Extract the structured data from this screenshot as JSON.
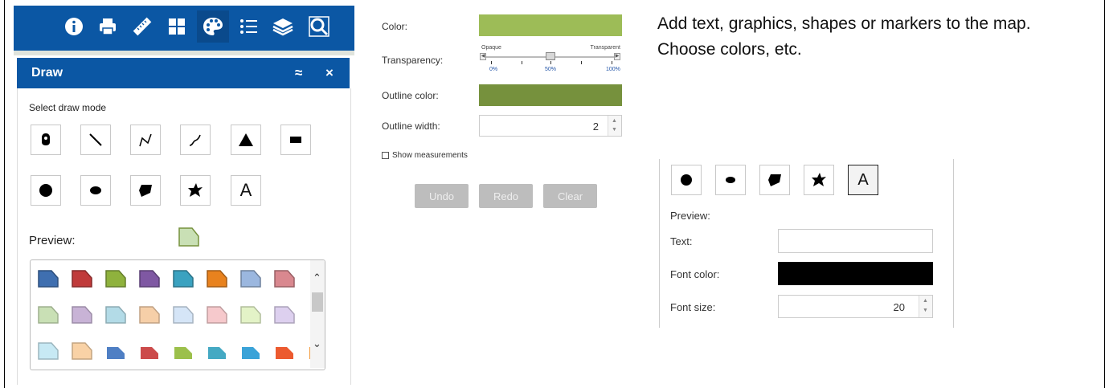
{
  "toolbar": {
    "icons": [
      "info-icon",
      "print-icon",
      "measure-icon",
      "basemap-gallery-icon",
      "draw-icon",
      "legend-icon",
      "layers-icon",
      "search-icon"
    ]
  },
  "draw_panel": {
    "title": "Draw",
    "collapse_glyph": "≈",
    "close_glyph": "×",
    "select_mode_label": "Select draw mode",
    "preview_label": "Preview:",
    "modes": [
      "point",
      "line",
      "polyline",
      "freehand-polyline",
      "triangle",
      "rectangle",
      "circle",
      "ellipse",
      "polygon",
      "freehand-polygon",
      "text"
    ],
    "text_mode_glyph": "A"
  },
  "palette": {
    "row1": [
      "#3f6fb0",
      "#c03a3a",
      "#8fb23d",
      "#7f58a3",
      "#3aa2c0",
      "#e8821e",
      "#9bb7df",
      "#d9888f"
    ],
    "row2": [
      "#c9e0b5",
      "#c8b3d6",
      "#b3dbe7",
      "#f6cfa8",
      "#d5e5f7",
      "#f6c9cc",
      "#e3f3c7",
      "#ddd0ef"
    ],
    "row3": [
      "#c7e9f4",
      "#f9d2a6",
      "#4f7fc4",
      "#cc4b4b",
      "#9cc04b",
      "#45a9c3",
      "#3ba3d8",
      "#ec5a2f",
      "#f39a3d"
    ]
  },
  "style_panel": {
    "color_label": "Color:",
    "color_value": "#9dbc57",
    "transparency_label": "Transparency:",
    "opaque_label": "Opaque",
    "transparent_label": "Transparent",
    "tick_0": "0%",
    "tick_50": "50%",
    "tick_100": "100%",
    "transparency_value": 0.5,
    "outline_color_label": "Outline color:",
    "outline_color_value": "#76913d",
    "outline_width_label": "Outline width:",
    "outline_width_value": "2",
    "show_measurements_label": "Show measurements",
    "undo_label": "Undo",
    "redo_label": "Redo",
    "clear_label": "Clear"
  },
  "description": "Add text, graphics, shapes or markers to the map. Choose colors, etc.",
  "text_panel": {
    "text_mode_glyph": "A",
    "preview_label": "Preview:",
    "text_label": "Text:",
    "text_value": "",
    "font_color_label": "Font color:",
    "font_color_value": "#000000",
    "font_size_label": "Font size:",
    "font_size_value": "20"
  }
}
